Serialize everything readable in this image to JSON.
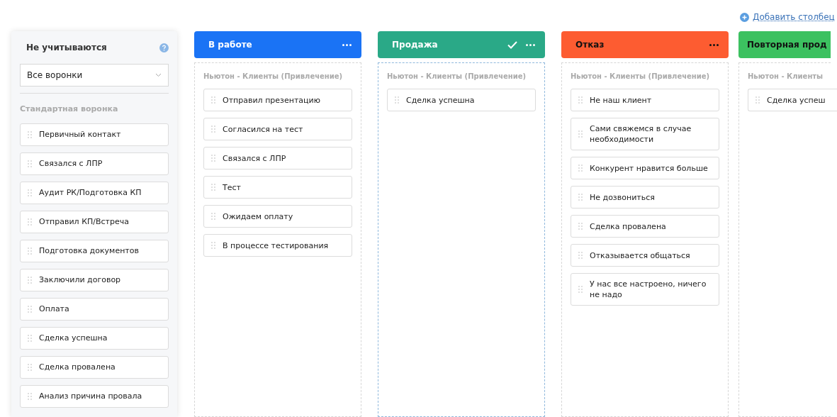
{
  "add_column_link": "Добавить столбец",
  "excluded_panel": {
    "title": "Не учитываются",
    "funnel_select": {
      "value": "Все воронки"
    },
    "group_label": "Стандартная воронка",
    "stages": [
      "Первичный контакт",
      "Связался с ЛПР",
      "Аудит РК/Подготовка КП",
      "Отправил КП/Встреча",
      "Подготовка документов",
      "Заключили договор",
      "Оплата",
      "Сделка успешна",
      "Сделка провалена",
      "Анализ причина провала"
    ]
  },
  "columns": [
    {
      "title": "В работе",
      "color": "#1a73f5",
      "checked": false,
      "menu": true,
      "funnel": "Ньютон - Клиенты (Привлечение)",
      "stages": [
        "Отправил презентацию",
        "Согласился на тест",
        "Связался с ЛПР",
        "Тест",
        "Ожидаем оплату",
        "В процессе тестирования"
      ]
    },
    {
      "title": "Продажа",
      "color": "#2aa987",
      "checked": true,
      "menu": true,
      "funnel": "Ньютон - Клиенты (Привлечение)",
      "stages": [
        "Сделка успешна"
      ]
    },
    {
      "title": "Отказ",
      "color": "#fd5c31",
      "checked": false,
      "menu": true,
      "funnel": "Ньютон - Клиенты (Привлечение)",
      "stages": [
        "Не наш клиент",
        "Сами свяжемся в случае необходимости",
        "Конкурент нравится больше",
        "Не дозвониться",
        "Сделка провалена",
        "Отказывается общаться",
        "У нас все настроено, ничего не надо"
      ]
    },
    {
      "title": "Повторная прод",
      "color": "#3cc160",
      "checked": false,
      "menu": false,
      "funnel": "Ньютон - Клиенты",
      "stages": [
        "Сделка успеш"
      ]
    }
  ]
}
